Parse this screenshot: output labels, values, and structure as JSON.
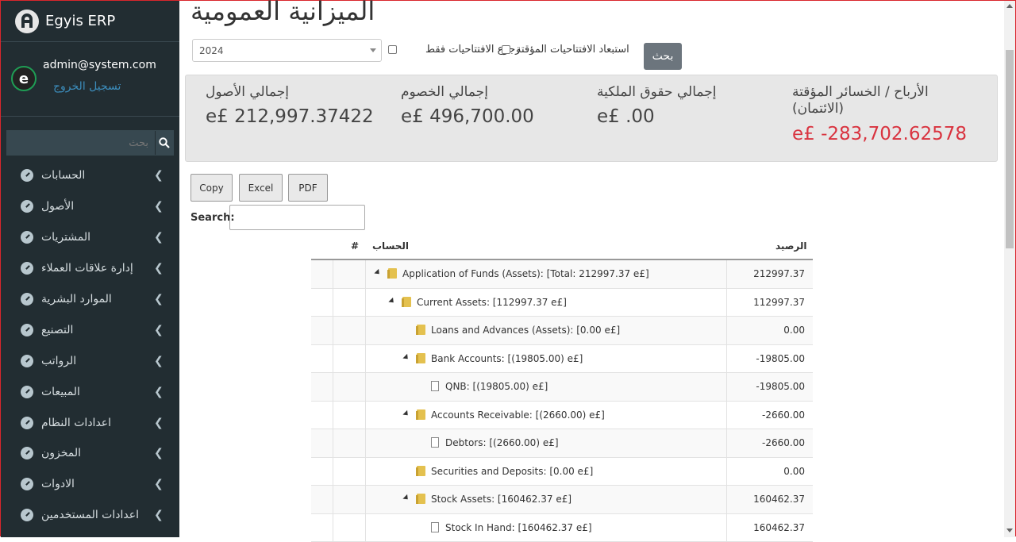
{
  "app": {
    "name": "Egyis ERP"
  },
  "user": {
    "email": "admin@system.com",
    "logout": "تسجيل الخروج"
  },
  "sidebar": {
    "search_placeholder": "بحث",
    "menu": [
      {
        "label": "الحسابات"
      },
      {
        "label": "الأصول"
      },
      {
        "label": "المشتريات"
      },
      {
        "label": "إدارة علاقات العملاء"
      },
      {
        "label": "الموارد البشرية"
      },
      {
        "label": "التصنيع"
      },
      {
        "label": "الرواتب"
      },
      {
        "label": "المبيعات"
      },
      {
        "label": "اعدادات النظام"
      },
      {
        "label": "المخزون"
      },
      {
        "label": "الادوات"
      },
      {
        "label": "اعدادات المستخدمين"
      }
    ]
  },
  "page": {
    "title": "الميزانية العمومية",
    "year": "2024",
    "exclude_temp": "استبعاد الافتتاحيات المؤقتة",
    "revert_only": "رجوع الافتتاحيات فقط",
    "search_button": "بحث"
  },
  "summary": {
    "assets_label": "إجمالي الأصول",
    "assets_value": "e£ 212,997.37422",
    "liabilities_label": "إجمالي الخصوم",
    "liabilities_value": "e£ 496,700.00",
    "equity_label": "إجمالي حقوق الملكية",
    "equity_value": "e£ .00",
    "pl_label_1": "الأرباح / الخسائر المؤقتة",
    "pl_label_2": "(الائتمان)",
    "pl_value": "e£ -283,702.62578",
    "pl_color": "#d9333f"
  },
  "table_tools": {
    "copy": "Copy",
    "excel": "Excel",
    "pdf": "PDF",
    "search_label": "Search:"
  },
  "tree": {
    "headers": {
      "num": "#",
      "account": "الحساب",
      "balance": "الرصيد"
    },
    "rows": [
      {
        "text": "Application of Funds (Assets): [Total: 212997.37 e£]",
        "balance": "212997.37",
        "type": "folder"
      },
      {
        "text": "Current Assets: [112997.37 e£]",
        "balance": "112997.37",
        "type": "folder"
      },
      {
        "text": "Loans and Advances (Assets): [0.00 e£]",
        "balance": "0.00",
        "type": "folder"
      },
      {
        "text": "Bank Accounts: [(19805.00) e£]",
        "balance": "-19805.00",
        "type": "folder"
      },
      {
        "text": "QNB: [(19805.00) e£]",
        "balance": "-19805.00",
        "type": "file"
      },
      {
        "text": "Accounts Receivable: [(2660.00) e£]",
        "balance": "-2660.00",
        "type": "folder"
      },
      {
        "text": "Debtors: [(2660.00) e£]",
        "balance": "-2660.00",
        "type": "file"
      },
      {
        "text": "Securities and Deposits: [0.00 e£]",
        "balance": "0.00",
        "type": "folder"
      },
      {
        "text": "Stock Assets: [160462.37 e£]",
        "balance": "160462.37",
        "type": "folder"
      },
      {
        "text": "Stock In Hand: [160462.37 e£]",
        "balance": "160462.37",
        "type": "file"
      }
    ]
  }
}
